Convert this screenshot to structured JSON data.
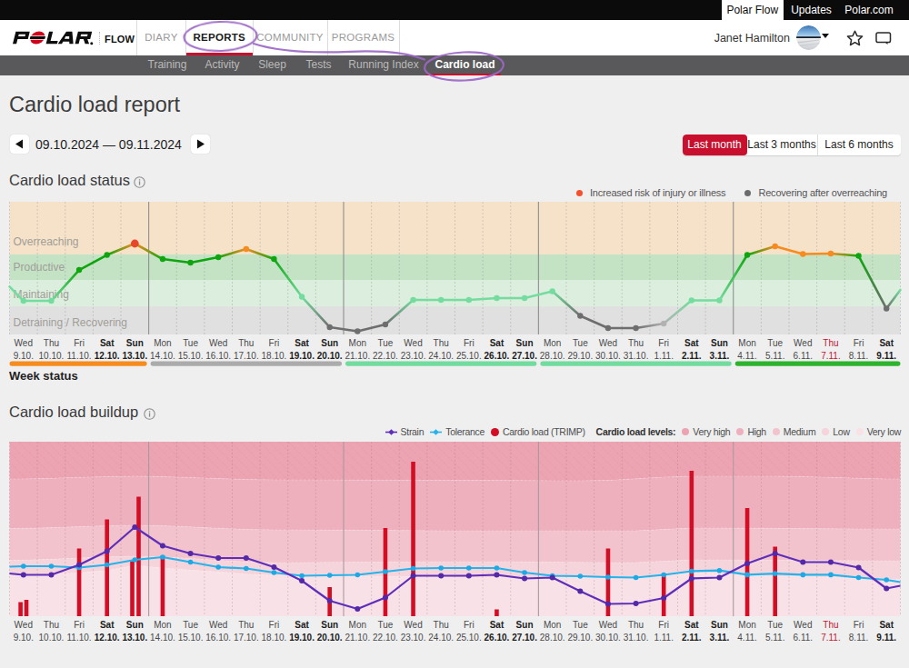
{
  "browser_bar": {
    "tabs": [
      {
        "label": "Polar Flow",
        "active": true
      },
      {
        "label": "Updates",
        "active": false
      },
      {
        "label": "Polar.com",
        "active": false
      }
    ]
  },
  "header": {
    "logo": "POLAR",
    "logo_suffix": "FLOW",
    "nav": [
      {
        "label": "DIARY",
        "active": false
      },
      {
        "label": "REPORTS",
        "active": true
      },
      {
        "label": "COMMUNITY",
        "active": false
      },
      {
        "label": "PROGRAMS",
        "active": false
      }
    ],
    "user_name": "Janet Hamilton"
  },
  "subnav": {
    "items": [
      {
        "label": "Training",
        "active": false
      },
      {
        "label": "Activity",
        "active": false
      },
      {
        "label": "Sleep",
        "active": false
      },
      {
        "label": "Tests",
        "active": false
      },
      {
        "label": "Running Index",
        "active": false
      },
      {
        "label": "Cardio load",
        "active": true
      }
    ]
  },
  "page": {
    "title": "Cardio load report",
    "date_range": "09.10.2024 — 09.11.2024",
    "period_buttons": [
      {
        "label": "Last month",
        "active": true
      },
      {
        "label": "Last 3 months",
        "active": false
      },
      {
        "label": "Last 6 months",
        "active": false
      }
    ]
  },
  "status_section": {
    "heading": "Cardio load status",
    "legend": [
      {
        "label": "Increased risk of injury or illness",
        "color": "#f4502b"
      },
      {
        "label": "Recovering after overreaching",
        "color": "#6b6b6b"
      }
    ],
    "week_status_label": "Week status"
  },
  "buildup_section": {
    "heading": "Cardio load buildup",
    "series_legend": [
      {
        "label": "Strain",
        "color": "#5e2eba",
        "marker": "line-diamond"
      },
      {
        "label": "Tolerance",
        "color": "#24b3ea",
        "marker": "line-diamond"
      },
      {
        "label": "Cardio load (TRIMP)",
        "color": "#d20d24",
        "marker": "dot"
      }
    ],
    "levels_label": "Cardio load levels:",
    "levels": [
      {
        "label": "Very high",
        "color": "#eda4b2"
      },
      {
        "label": "High",
        "color": "#efb0be"
      },
      {
        "label": "Medium",
        "color": "#f3c3cd"
      },
      {
        "label": "Low",
        "color": "#f6d4db"
      },
      {
        "label": "Very low",
        "color": "#f9e2e7"
      }
    ]
  },
  "chart_data": {
    "days": [
      {
        "dow": "Wed",
        "date": "9.10.",
        "weekend": false,
        "highlight": false
      },
      {
        "dow": "Thu",
        "date": "10.10.",
        "weekend": false,
        "highlight": false
      },
      {
        "dow": "Fri",
        "date": "11.10.",
        "weekend": false,
        "highlight": false
      },
      {
        "dow": "Sat",
        "date": "12.10.",
        "weekend": true,
        "highlight": false
      },
      {
        "dow": "Sun",
        "date": "13.10.",
        "weekend": true,
        "highlight": false
      },
      {
        "dow": "Mon",
        "date": "14.10.",
        "weekend": false,
        "highlight": false
      },
      {
        "dow": "Tue",
        "date": "15.10.",
        "weekend": false,
        "highlight": false
      },
      {
        "dow": "Wed",
        "date": "16.10.",
        "weekend": false,
        "highlight": false
      },
      {
        "dow": "Thu",
        "date": "17.10.",
        "weekend": false,
        "highlight": false
      },
      {
        "dow": "Fri",
        "date": "18.10.",
        "weekend": false,
        "highlight": false
      },
      {
        "dow": "Sat",
        "date": "19.10.",
        "weekend": true,
        "highlight": false
      },
      {
        "dow": "Sun",
        "date": "20.10.",
        "weekend": true,
        "highlight": false
      },
      {
        "dow": "Mon",
        "date": "21.10.",
        "weekend": false,
        "highlight": false
      },
      {
        "dow": "Tue",
        "date": "22.10.",
        "weekend": false,
        "highlight": false
      },
      {
        "dow": "Wed",
        "date": "23.10.",
        "weekend": false,
        "highlight": false
      },
      {
        "dow": "Thu",
        "date": "24.10.",
        "weekend": false,
        "highlight": false
      },
      {
        "dow": "Fri",
        "date": "25.10.",
        "weekend": false,
        "highlight": false
      },
      {
        "dow": "Sat",
        "date": "26.10.",
        "weekend": true,
        "highlight": false
      },
      {
        "dow": "Sun",
        "date": "27.10.",
        "weekend": true,
        "highlight": false
      },
      {
        "dow": "Mon",
        "date": "28.10.",
        "weekend": false,
        "highlight": false
      },
      {
        "dow": "Tue",
        "date": "29.10.",
        "weekend": false,
        "highlight": false
      },
      {
        "dow": "Wed",
        "date": "30.10.",
        "weekend": false,
        "highlight": false
      },
      {
        "dow": "Thu",
        "date": "31.10.",
        "weekend": false,
        "highlight": false
      },
      {
        "dow": "Fri",
        "date": "1.11.",
        "weekend": false,
        "highlight": false
      },
      {
        "dow": "Sat",
        "date": "2.11.",
        "weekend": true,
        "highlight": false
      },
      {
        "dow": "Sun",
        "date": "3.11.",
        "weekend": true,
        "highlight": false
      },
      {
        "dow": "Mon",
        "date": "4.11.",
        "weekend": false,
        "highlight": false
      },
      {
        "dow": "Tue",
        "date": "5.11.",
        "weekend": false,
        "highlight": false
      },
      {
        "dow": "Wed",
        "date": "6.11.",
        "weekend": false,
        "highlight": false
      },
      {
        "dow": "Thu",
        "date": "7.11.",
        "weekend": false,
        "highlight": true
      },
      {
        "dow": "Fri",
        "date": "8.11.",
        "weekend": false,
        "highlight": false
      },
      {
        "dow": "Sat",
        "date": "9.11.",
        "weekend": true,
        "highlight": false
      }
    ],
    "status_chart": {
      "type": "line",
      "title": "Cardio load status",
      "ylim": [
        0,
        1
      ],
      "grid": true,
      "bands": [
        {
          "label": "Overreaching",
          "color": "#f6e2c8",
          "from": 0.603,
          "to": 1.0
        },
        {
          "label": "Productive",
          "color": "#c4e3c5",
          "from": 0.411,
          "to": 0.603
        },
        {
          "label": "Maintaining",
          "color": "#dceedd",
          "from": 0.212,
          "to": 0.411
        },
        {
          "label": "Detraining / Recovering",
          "color": "#e0e0e1",
          "from": 0.0,
          "to": 0.212
        }
      ],
      "status_colors": {
        "maintaining": "#74dc9f",
        "productive": "#0ea50e",
        "overreaching": "#f68b1f",
        "risk": "#e8462b",
        "recovering": "#6e6e6e",
        "recovering_light": "#b2b2b2"
      },
      "points": [
        {
          "v": 0.253,
          "status": "maintaining"
        },
        {
          "v": 0.253,
          "status": "maintaining"
        },
        {
          "v": 0.486,
          "status": "productive"
        },
        {
          "v": 0.599,
          "status": "productive"
        },
        {
          "v": 0.685,
          "status": "risk"
        },
        {
          "v": 0.568,
          "status": "productive"
        },
        {
          "v": 0.541,
          "status": "productive"
        },
        {
          "v": 0.582,
          "status": "productive"
        },
        {
          "v": 0.644,
          "status": "overreaching"
        },
        {
          "v": 0.568,
          "status": "productive"
        },
        {
          "v": 0.284,
          "status": "maintaining"
        },
        {
          "v": 0.055,
          "status": "recovering"
        },
        {
          "v": 0.024,
          "status": "recovering"
        },
        {
          "v": 0.075,
          "status": "recovering"
        },
        {
          "v": 0.26,
          "status": "maintaining"
        },
        {
          "v": 0.26,
          "status": "maintaining"
        },
        {
          "v": 0.26,
          "status": "maintaining"
        },
        {
          "v": 0.274,
          "status": "maintaining"
        },
        {
          "v": 0.274,
          "status": "maintaining"
        },
        {
          "v": 0.325,
          "status": "maintaining"
        },
        {
          "v": 0.14,
          "status": "recovering"
        },
        {
          "v": 0.048,
          "status": "recovering"
        },
        {
          "v": 0.048,
          "status": "recovering"
        },
        {
          "v": 0.082,
          "status": "recovering_light"
        },
        {
          "v": 0.257,
          "status": "maintaining"
        },
        {
          "v": 0.257,
          "status": "maintaining"
        },
        {
          "v": 0.599,
          "status": "productive"
        },
        {
          "v": 0.664,
          "status": "overreaching"
        },
        {
          "v": 0.606,
          "status": "overreaching"
        },
        {
          "v": 0.61,
          "status": "overreaching"
        },
        {
          "v": 0.592,
          "status": "productive"
        },
        {
          "v": 0.195,
          "status": "recovering"
        }
      ],
      "edge_values": {
        "left_v": 0.36,
        "left_status": "maintaining",
        "right_v": 0.336,
        "right_status": "maintaining"
      },
      "week_status": [
        {
          "from": 0,
          "to": 4,
          "status": "overreaching",
          "color": "#f68b1f"
        },
        {
          "from": 5,
          "to": 11,
          "status": "recovering",
          "color": "#ababab"
        },
        {
          "from": 12,
          "to": 18,
          "status": "maintaining",
          "color": "#72dc9e"
        },
        {
          "from": 19,
          "to": 25,
          "status": "maintaining",
          "color": "#72dc9e"
        },
        {
          "from": 26,
          "to": 31,
          "status": "productive",
          "color": "#2db32d"
        }
      ]
    },
    "buildup_chart": {
      "type": "combo",
      "title": "Cardio load buildup",
      "ylim": [
        0,
        192
      ],
      "strain": {
        "name": "Strain",
        "color": "#5e2eba",
        "point_color": "#5329a8",
        "edge_left": 47,
        "edge_right": 33.5,
        "values": [
          45.5,
          45.5,
          56.5,
          71.5,
          98,
          77.5,
          69,
          64,
          64,
          54,
          39,
          17,
          8,
          20.5,
          44.5,
          44.5,
          44.5,
          45.5,
          41.5,
          42.5,
          27.5,
          13.5,
          14,
          20,
          41.5,
          42.5,
          58,
          69,
          59.5,
          59.5,
          53.5,
          30.5
        ]
      },
      "tolerance": {
        "name": "Tolerance",
        "color": "#24b3ea",
        "point_color": "#1ea9e4",
        "edge_left": 54.5,
        "edge_right": 37.5,
        "values": [
          55,
          55,
          53.5,
          56.5,
          62,
          65,
          59.5,
          54,
          52.5,
          48,
          44.5,
          45,
          45.5,
          49,
          52.5,
          53,
          53,
          53,
          48,
          44.5,
          44,
          43,
          42.5,
          45.5,
          49.5,
          50.3,
          45.6,
          46.9,
          45.6,
          45.6,
          42.5,
          40
        ]
      },
      "trimp": {
        "name": "Cardio load (TRIMP)",
        "color": "#d20d24",
        "bar_width": 4.6,
        "bars": [
          {
            "day": 0,
            "offset": -3.2,
            "value": 15.5
          },
          {
            "day": 0,
            "offset": 3.2,
            "value": 18
          },
          {
            "day": 2,
            "offset": 0,
            "value": 74.5
          },
          {
            "day": 3,
            "offset": 0,
            "value": 106.5
          },
          {
            "day": 4,
            "offset": -2.8,
            "value": 60.5
          },
          {
            "day": 4,
            "offset": 4.2,
            "value": 131.5
          },
          {
            "day": 5,
            "offset": 0,
            "value": 66.5
          },
          {
            "day": 11,
            "offset": 0,
            "value": 32
          },
          {
            "day": 13,
            "offset": 0,
            "value": 97
          },
          {
            "day": 14,
            "offset": 0,
            "value": 170
          },
          {
            "day": 17,
            "offset": 0,
            "value": 7.5
          },
          {
            "day": 21,
            "offset": 0,
            "value": 74.5
          },
          {
            "day": 23,
            "offset": 0,
            "value": 46.5
          },
          {
            "day": 24,
            "offset": 0,
            "value": 160
          },
          {
            "day": 26,
            "offset": 0,
            "value": 119
          },
          {
            "day": 27,
            "offset": 0,
            "value": 76.5
          }
        ]
      },
      "level_bands": {
        "colors": [
          "#eda4b2",
          "#efb0be",
          "#f3c3cd",
          "#f6d4db",
          "#f9e2e7"
        ],
        "labels": [
          "Very high",
          "High",
          "Medium",
          "Low",
          "Very low"
        ],
        "boundaries": [
          {
            "name": "very-high-low",
            "points": [
              [
                10.5,
                151
              ],
              [
                150,
                154
              ],
              [
                300,
                150
              ],
              [
                520,
                149.5
              ],
              [
                650,
                149
              ],
              [
                760,
                154
              ],
              [
                850,
                154
              ],
              [
                990.5,
                151
              ]
            ]
          },
          {
            "name": "high-medium",
            "points": [
              [
                10.5,
                96.5
              ],
              [
                150,
                100
              ],
              [
                300,
                95
              ],
              [
                520,
                94
              ],
              [
                700,
                94
              ],
              [
                760,
                97
              ],
              [
                990.5,
                96
              ]
            ]
          },
          {
            "name": "medium-low",
            "points": [
              [
                10.5,
                61.5
              ],
              [
                150,
                66
              ],
              [
                300,
                59
              ],
              [
                520,
                60
              ],
              [
                700,
                59
              ],
              [
                760,
                62
              ],
              [
                990.5,
                61
              ]
            ]
          },
          {
            "name": "low-very-low",
            "points": [
              [
                10.5,
                44.5
              ],
              [
                100,
                48
              ],
              [
                150,
                56
              ],
              [
                200,
                51
              ],
              [
                300,
                45
              ],
              [
                520,
                43
              ],
              [
                700,
                43
              ],
              [
                760,
                48
              ],
              [
                850,
                44
              ],
              [
                990.5,
                41
              ]
            ]
          }
        ]
      }
    }
  }
}
